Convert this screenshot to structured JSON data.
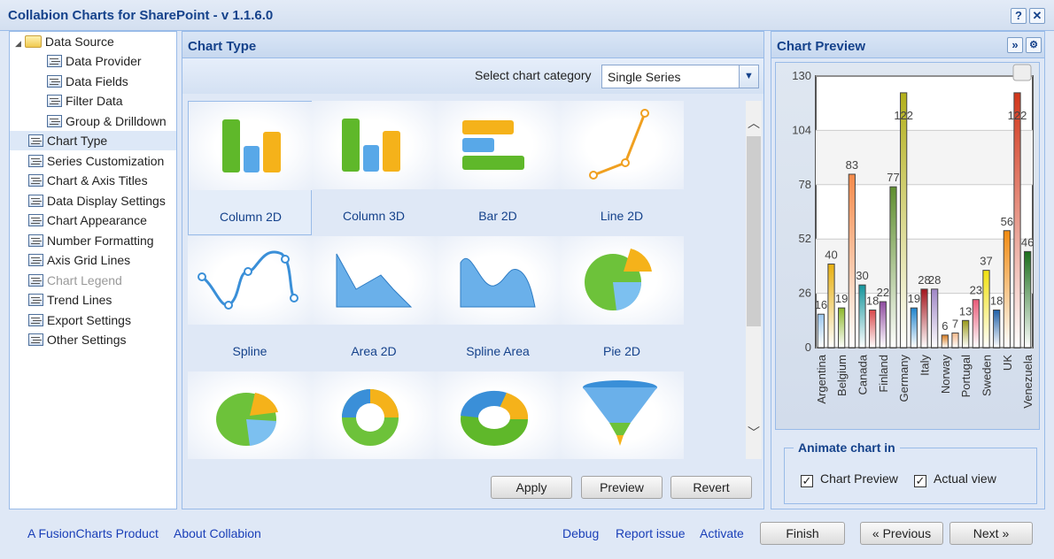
{
  "window": {
    "title": "Collabion Charts for SharePoint - v 1.1.6.0",
    "help_label": "?",
    "close_label": "✕"
  },
  "tree": {
    "root": "Data Source",
    "children": [
      "Data Provider",
      "Data Fields",
      "Filter Data",
      "Group & Drilldown"
    ],
    "items": [
      {
        "label": "Chart Type",
        "selected": true
      },
      {
        "label": "Series Customization"
      },
      {
        "label": "Chart & Axis Titles"
      },
      {
        "label": "Data Display Settings"
      },
      {
        "label": "Chart Appearance"
      },
      {
        "label": "Number Formatting"
      },
      {
        "label": "Axis Grid Lines"
      },
      {
        "label": "Chart Legend",
        "disabled": true
      },
      {
        "label": "Trend Lines"
      },
      {
        "label": "Export Settings"
      },
      {
        "label": "Other Settings"
      }
    ]
  },
  "chart_type": {
    "title": "Chart Type",
    "category_label": "Select chart category",
    "category_value": "Single Series",
    "tiles": [
      "Column 2D",
      "Column 3D",
      "Bar 2D",
      "Line 2D",
      "Spline",
      "Area 2D",
      "Spline Area",
      "Pie 2D",
      "Pie 3D",
      "Doughnut 2D",
      "Doughnut 3D",
      "Funnel"
    ],
    "selected": "Column 2D",
    "apply": "Apply",
    "preview": "Preview",
    "revert": "Revert"
  },
  "preview": {
    "title": "Chart Preview",
    "expand_icon": "»",
    "settings_icon": "gear-icon",
    "animate": {
      "legend": "Animate chart in",
      "chart_preview": "Chart Preview",
      "chart_preview_checked": true,
      "actual_view": "Actual view",
      "actual_view_checked": true
    }
  },
  "chart_data": {
    "type": "bar",
    "orientation": "vertical",
    "ylim": [
      0,
      130
    ],
    "yticks": [
      "0",
      "26",
      "52",
      "78",
      "104",
      "130"
    ],
    "grid": true,
    "categories": [
      "Argentina",
      "",
      "Belgium",
      "",
      "Canada",
      "",
      "Finland",
      "",
      "Germany",
      "",
      "Italy",
      "",
      "Norway",
      "",
      "Portugal",
      "",
      "Sweden",
      "",
      "UK",
      "",
      "Venezuela"
    ],
    "values": [
      16,
      40,
      19,
      83,
      30,
      18,
      22,
      77,
      122,
      19,
      28,
      28,
      6,
      7,
      13,
      23,
      37,
      18,
      56,
      122,
      46
    ],
    "colors": [
      "#9cc7ef",
      "#e8b010",
      "#8db82b",
      "#f58a4a",
      "#14959c",
      "#d9484a",
      "#8e4aa0",
      "#5f8f2f",
      "#b3b01a",
      "#1f84cc",
      "#a3141c",
      "#9f86c6",
      "#d57a1f",
      "#f5b88a",
      "#9a9a1a",
      "#e85a78",
      "#f0e010",
      "#1f5fa8",
      "#f08a10",
      "#d2361a",
      "#1b6e1b"
    ]
  },
  "footer": {
    "fusion": "A FusionCharts Product",
    "about": "About Collabion",
    "debug": "Debug",
    "report": "Report issue",
    "activate": "Activate",
    "finish": "Finish",
    "previous": "« Previous",
    "next": "Next »"
  }
}
